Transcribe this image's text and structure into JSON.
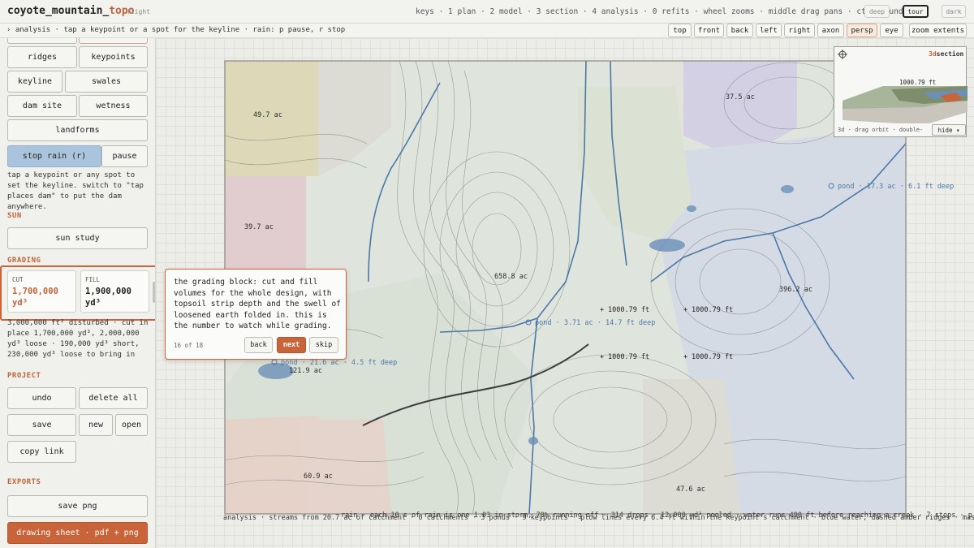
{
  "header": {
    "title_main": "coyote_mountain_",
    "title_accent": "topo",
    "mode": "flight",
    "keys_hint": "keys · 1 plan · 2 model · 3 section · 4 analysis · 0 refits · wheel zooms · middle drag pans · ctrl+z undo",
    "theme_buttons": [
      "deep",
      "tour",
      "dark"
    ],
    "active_theme": "tour"
  },
  "subbar": {
    "hint": "› analysis · tap a keypoint or a spot for the keyline · rain: p pause, r stop",
    "view_buttons": [
      "top",
      "front",
      "back",
      "left",
      "right",
      "axon",
      "persp",
      "eye"
    ],
    "active_view": "persp",
    "zoom_extents": "zoom extents"
  },
  "sidebar": {
    "analysis_buttons": [
      "ridges",
      "keypoints",
      "keyline",
      "swales",
      "dam site",
      "wetness",
      "landforms"
    ],
    "stop_rain": "stop rain (r)",
    "pause": "pause",
    "help": "tap a keypoint or any spot to set the keyline. switch to \"tap places dam\" to put the dam anywhere.",
    "sun_heading": "SUN",
    "sun_study": "sun study",
    "grading_heading": "GRADING",
    "cut_label": "CUT",
    "cut_value": "1,700,000 yd³",
    "fill_label": "FILL",
    "fill_value": "1,900,000 yd³",
    "grading_summary": "3,000,000 ft² disturbed · cut in place 1,700,000 yd³, 2,000,000 yd³ loose · 190,000 yd³ short, 230,000 yd³ loose to bring in",
    "project_heading": "PROJECT",
    "undo": "undo",
    "delete_all": "delete all",
    "save": "save",
    "new": "new",
    "open": "open",
    "copy_link": "copy link",
    "exports_heading": "EXPORTS",
    "save_png": "save png",
    "drawing_sheet": "drawing sheet · pdf + png"
  },
  "map": {
    "areas": [
      "49.7 ac",
      "37.5 ac",
      "39.7 ac",
      "658.8 ac",
      "396.2 ac",
      "121.9 ac",
      "60.9 ac",
      "47.6 ac"
    ],
    "ponds": [
      "pond · 17.3 ac · 6.1 ft deep",
      "pond · 3.71 ac · 14.7 ft deep",
      "pond · 21.6 ac · 4.5 ft deep"
    ],
    "elevations": [
      "1000.79 ft",
      "1000.79 ft",
      "1000.79 ft",
      "1000.79 ft"
    ],
    "colors": {
      "orange": "#c9643a",
      "water": "#4b78a8",
      "pond": "#6b90b8"
    }
  },
  "inset": {
    "title_accent": "3d",
    "title_rest": "section",
    "elevation_label": "1000.79 ft",
    "footer": "3d · drag orbit · double-",
    "hide": "hide ▾"
  },
  "status": {
    "analysis": "analysis · streams from 20.7 ac of catchment · 0 catchments · 3 ponds · 9 keypoints · plow lines every 6.4 ft within the keypoint's catchment · blue water, dashed amber ridges · mask: ember fi",
    "rain": "rain · each 10 s of rain is one 1.03 in storm, 70% running off · 314 drops · 12,000 yd³ pooled · water runs 490 ft before reaching a creek · 7 stops · p pauses"
  },
  "tour": {
    "text": "the grading block: cut and fill volumes for the whole design, with topsoil strip depth and the swell of loosened earth folded in. this is the number to watch while grading.",
    "step": "16 of 18",
    "back": "back",
    "next": "next",
    "skip": "skip"
  }
}
